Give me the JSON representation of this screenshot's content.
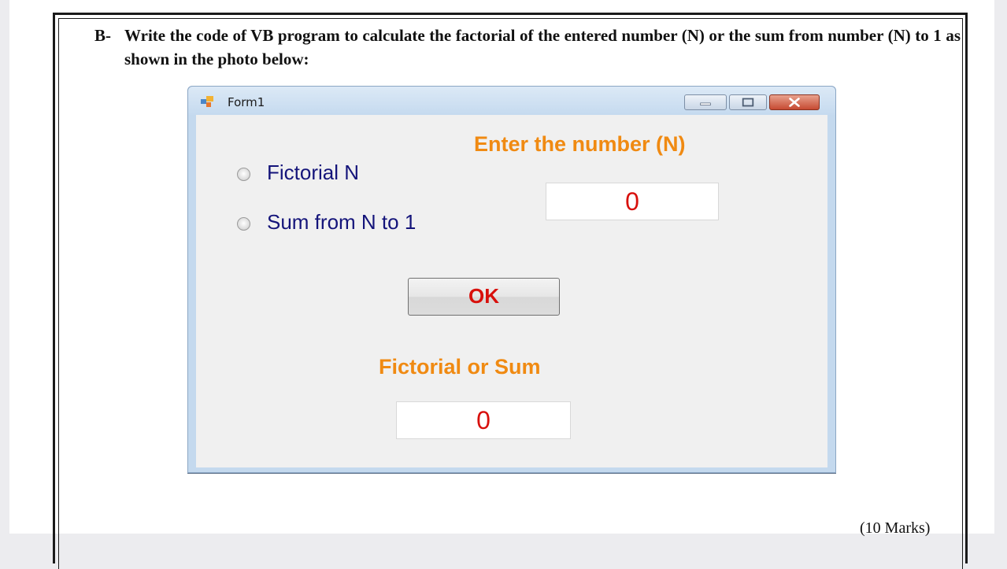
{
  "question": {
    "label": "B-",
    "text": "Write the code of VB program to calculate the factorial of the entered number (N) or the sum from number (N) to 1 as  shown in the photo below:",
    "marks": "(10  Marks)"
  },
  "form": {
    "title": "Form1",
    "radio_factorial_label": "Fictorial N",
    "radio_sum_label": "Sum from N to 1",
    "enter_label": "Enter the number (N)",
    "number_value": "0",
    "ok_label": "OK",
    "result_label": "Fictorial or Sum",
    "result_value": "0"
  },
  "colors": {
    "label_orange": "#f08a12",
    "value_red": "#d8100c",
    "radio_text_blue": "#14147a",
    "window_frame": "#c4d9ee"
  },
  "icons": {
    "app": "form-app-icon",
    "minimize": "minimize-icon",
    "maximize": "maximize-icon",
    "close": "close-icon"
  }
}
